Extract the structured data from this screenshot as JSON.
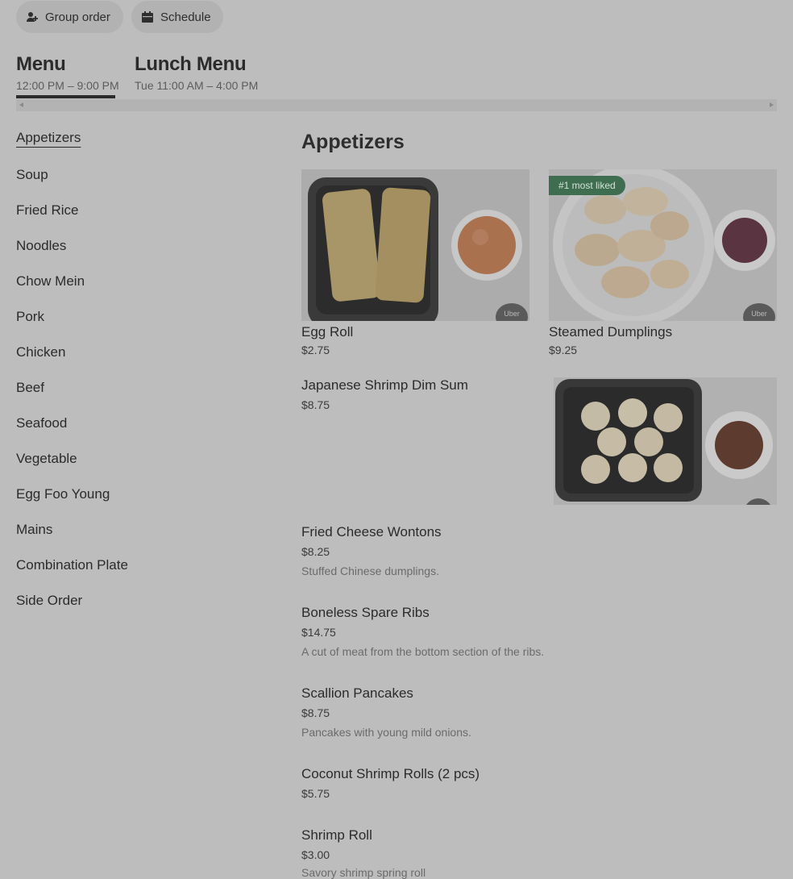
{
  "top_actions": {
    "group_order_label": "Group order",
    "schedule_label": "Schedule"
  },
  "menus": [
    {
      "title": "Menu",
      "hours": "12:00 PM – 9:00 PM",
      "selected": true
    },
    {
      "title": "Lunch Menu",
      "hours": "Tue 11:00 AM – 4:00 PM",
      "selected": false
    }
  ],
  "categories": [
    "Appetizers",
    "Soup",
    "Fried Rice",
    "Noodles",
    "Chow Mein",
    "Pork",
    "Chicken",
    "Beef",
    "Seafood",
    "Vegetable",
    "Egg Foo Young",
    "Mains",
    "Combination Plate",
    "Side Order"
  ],
  "active_category": "Appetizers",
  "section": {
    "title": "Appetizers",
    "featured": [
      {
        "name": "Egg Roll",
        "price": "$2.75",
        "photo_badge": "Uber"
      },
      {
        "name": "Steamed Dumplings",
        "price": "$9.25",
        "badge": "#1 most liked",
        "photo_badge": "Uber"
      }
    ],
    "items": [
      {
        "name": "Japanese Shrimp Dim Sum",
        "price": "$8.75",
        "has_photo": true
      },
      {
        "name": "Fried Cheese Wontons",
        "price": "$8.25",
        "description": "Stuffed Chinese dumplings."
      },
      {
        "name": "Boneless Spare Ribs",
        "price": "$14.75",
        "description": "A cut of meat from the bottom section of the ribs."
      },
      {
        "name": "Scallion Pancakes",
        "price": "$8.75",
        "description": "Pancakes with young mild onions."
      },
      {
        "name": "Coconut Shrimp Rolls (2 pcs)",
        "price": "$5.75"
      },
      {
        "name": "Shrimp Roll",
        "price": "$3.00",
        "description": "Savory shrimp spring roll"
      }
    ]
  },
  "colors": {
    "overlay_background": "#bdbdbd",
    "badge_green": "#3e6e4f",
    "text_dark": "#2b2b2b"
  }
}
